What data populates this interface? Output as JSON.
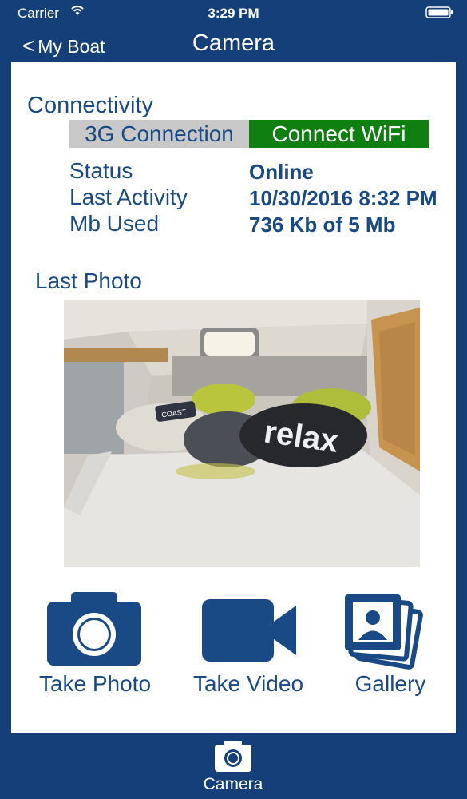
{
  "status_bar": {
    "carrier": "Carrier",
    "time": "3:29 PM"
  },
  "nav": {
    "back_label": "My Boat",
    "back_chevron": "<",
    "title": "Camera"
  },
  "connectivity": {
    "title": "Connectivity",
    "options": [
      "3G Connection",
      "Connect WiFi"
    ],
    "rows": [
      {
        "label": "Status",
        "value": "Online"
      },
      {
        "label": "Last Activity",
        "value": "10/30/2016 8:32 PM"
      },
      {
        "label": "Mb Used",
        "value": "736 Kb of 5 Mb"
      }
    ]
  },
  "last_photo": {
    "title": "Last Photo",
    "pillow_text": "relax",
    "pillow_small_text": "COAST"
  },
  "actions": [
    {
      "label": "Take Photo",
      "icon": "camera-icon"
    },
    {
      "label": "Take Video",
      "icon": "video-camera-icon"
    },
    {
      "label": "Gallery",
      "icon": "gallery-icon"
    }
  ],
  "tab_bar": {
    "items": [
      {
        "label": "Camera",
        "icon": "camera-icon"
      }
    ]
  },
  "colors": {
    "brand_blue": "#153f78",
    "text_blue": "#1a4a86",
    "wifi_green": "#0f7f12",
    "segment_gray": "#c8c8c8"
  }
}
